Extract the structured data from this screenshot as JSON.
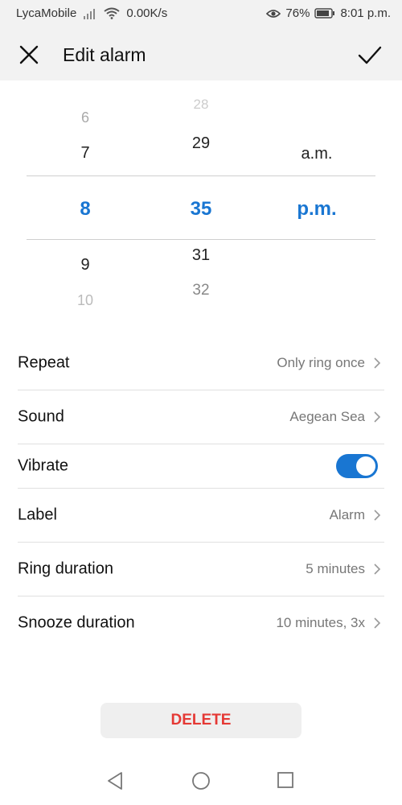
{
  "status_bar": {
    "carrier": "LycaMobile",
    "speed": "0.00K/s",
    "battery": "76%",
    "time": "8:01 p.m."
  },
  "app_bar": {
    "title": "Edit alarm"
  },
  "time_picker": {
    "hour": {
      "above_far": "6",
      "above": "7",
      "selected": "8",
      "below": "9",
      "below_far": "10"
    },
    "minute": {
      "above_far": "28",
      "above": "29",
      "selected": "35",
      "below": "31",
      "below_far": "32"
    },
    "period": {
      "above": "a.m.",
      "selected": "p.m."
    }
  },
  "settings": {
    "repeat": {
      "label": "Repeat",
      "value": "Only ring once"
    },
    "sound": {
      "label": "Sound",
      "value": "Aegean Sea"
    },
    "vibrate": {
      "label": "Vibrate",
      "enabled": true
    },
    "label": {
      "label": "Label",
      "value": "Alarm"
    },
    "ring_duration": {
      "label": "Ring duration",
      "value": "5 minutes"
    },
    "snooze_duration": {
      "label": "Snooze duration",
      "value": "10 minutes, 3x"
    }
  },
  "delete_button": {
    "label": "DELETE"
  },
  "icons": [
    "close-icon",
    "check-icon",
    "chevron-right-icon",
    "back-nav-icon",
    "home-nav-icon",
    "recents-nav-icon",
    "signal-icon",
    "wifi-icon",
    "eye-icon",
    "battery-icon"
  ],
  "colors": {
    "accent": "#1976d2",
    "delete": "#e53935",
    "header_bg": "#f2f2f2"
  }
}
